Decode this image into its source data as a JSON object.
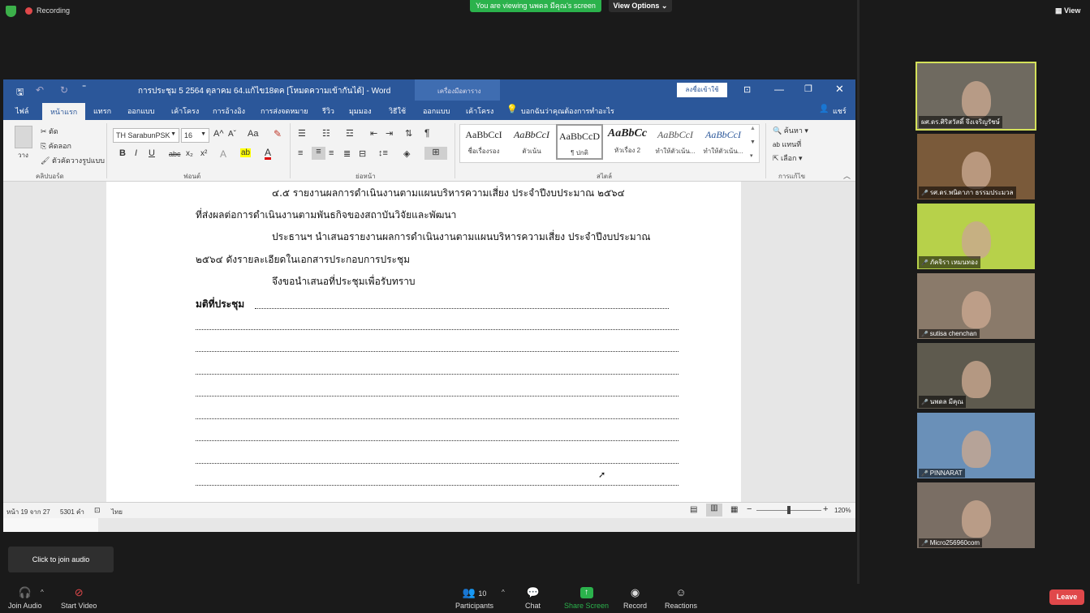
{
  "zoom_top": {
    "recording_label": "Recording",
    "viewing_banner": "You are viewing นพดล มีคุณ's screen",
    "view_options": "View Options ⌄",
    "view_button": "View"
  },
  "word": {
    "title": "การประชุม 5  2564 ตุลาคม  64.แก้ไข18ตค [โหมดความเข้ากันได้]  -  Word",
    "contextual": "เครื่องมือตาราง",
    "signin": "ลงชื่อเข้าใช้",
    "tabs": [
      "ไฟล์",
      "หน้าแรก",
      "แทรก",
      "ออกแบบ",
      "เค้าโครง",
      "การอ้างอิง",
      "การส่งจดหมาย",
      "รีวิว",
      "มุมมอง",
      "วิธีใช้",
      "ออกแบบ",
      "เค้าโครง"
    ],
    "tell_me": "บอกฉันว่าคุณต้องการทำอะไร",
    "share": "แชร์",
    "clipboard": {
      "paste": "วาง",
      "cut": "ตัด",
      "copy": "คัดลอก",
      "format_painter": "ตัวคัดวางรูปแบบ",
      "label": "คลิปบอร์ด"
    },
    "font": {
      "name": "TH SarabunPSK",
      "size": "16",
      "label": "ฟอนต์",
      "bold": "B",
      "italic": "I",
      "underline": "U",
      "strike": "abc",
      "sub": "x₂",
      "sup": "x²",
      "grow": "A^",
      "shrink": "Aˇ",
      "case": "Aa",
      "text_effects": "A",
      "highlight": "ab",
      "font_color": "A"
    },
    "paragraph": {
      "label": "ย่อหน้า"
    },
    "styles": {
      "label": "สไตล์",
      "items": [
        {
          "sample": "AaBbCcI",
          "name": "ชื่อเรื่องรอง"
        },
        {
          "sample": "AaBbCcI",
          "name": "ตัวเน้น"
        },
        {
          "sample": "AaBbCcD",
          "name": "¶ ปกติ"
        },
        {
          "sample": "AaBbCc",
          "name": "หัวเรื่อง 2"
        },
        {
          "sample": "AaBbCcI",
          "name": "ทำให้ตัวเน้น..."
        },
        {
          "sample": "AaBbCcI",
          "name": "ทำให้ตัวเน้น..."
        }
      ]
    },
    "editing": {
      "find": "ค้นหา",
      "replace": "แทนที่",
      "select": "เลือก",
      "label": "การแก้ไข"
    },
    "document": {
      "line1": "๔.๕ รายงานผลการดำเนินงานตามแผนบริหารความเสี่ยง ประจำปีงบประมาณ ๒๕๖๔",
      "line2": "ที่ส่งผลต่อการดำเนินงานตามพันธกิจของสถาบันวิจัยและพัฒนา",
      "line3": "ประธานฯ นำเสนอรายงานผลการดำเนินงานตามแผนบริหารความเสี่ยง ประจำปีงบประมาณ",
      "line4": "๒๕๖๔ ดังรายละเอียดในเอกสารประกอบการประชุม",
      "line5": "จึงขอนำเสนอที่ประชุมเพื่อรับทราบ",
      "resolution": "มติที่ประชุม"
    },
    "status": {
      "page": "หน้า 19 จาก 27",
      "words": "5301 คำ",
      "language": "ไทย",
      "zoom": "120%"
    }
  },
  "participants": [
    {
      "name": "ผศ.ดร.ศิริสวัสดิ์ จึงเจริญรัชษ์",
      "muted": false,
      "active": true,
      "bg": "#6f6a60"
    },
    {
      "name": "รศ.ดร.พนิดาภา ธรรมประมวล",
      "muted": true,
      "active": false,
      "bg": "#7a5a3a"
    },
    {
      "name": "ภัคจิรา เหมนทอง",
      "muted": true,
      "active": false,
      "bg": "#b7d14a"
    },
    {
      "name": "sutisa chenchan",
      "muted": true,
      "active": false,
      "bg": "#8a7a6a"
    },
    {
      "name": "นพดล มีคุณ",
      "muted": true,
      "active": false,
      "bg": "#5e5a4e"
    },
    {
      "name": "PINNARAT",
      "muted": true,
      "active": false,
      "bg": "#6a90b8"
    },
    {
      "name": "Micro256960com",
      "muted": true,
      "active": false,
      "bg": "#7a6e64"
    }
  ],
  "toolbar": {
    "join_audio": "Join Audio",
    "start_video": "Start Video",
    "participants": "Participants",
    "participant_count": "10",
    "chat": "Chat",
    "share_screen": "Share Screen",
    "record": "Record",
    "reactions": "Reactions",
    "leave": "Leave",
    "tooltip": "Click to join audio"
  }
}
